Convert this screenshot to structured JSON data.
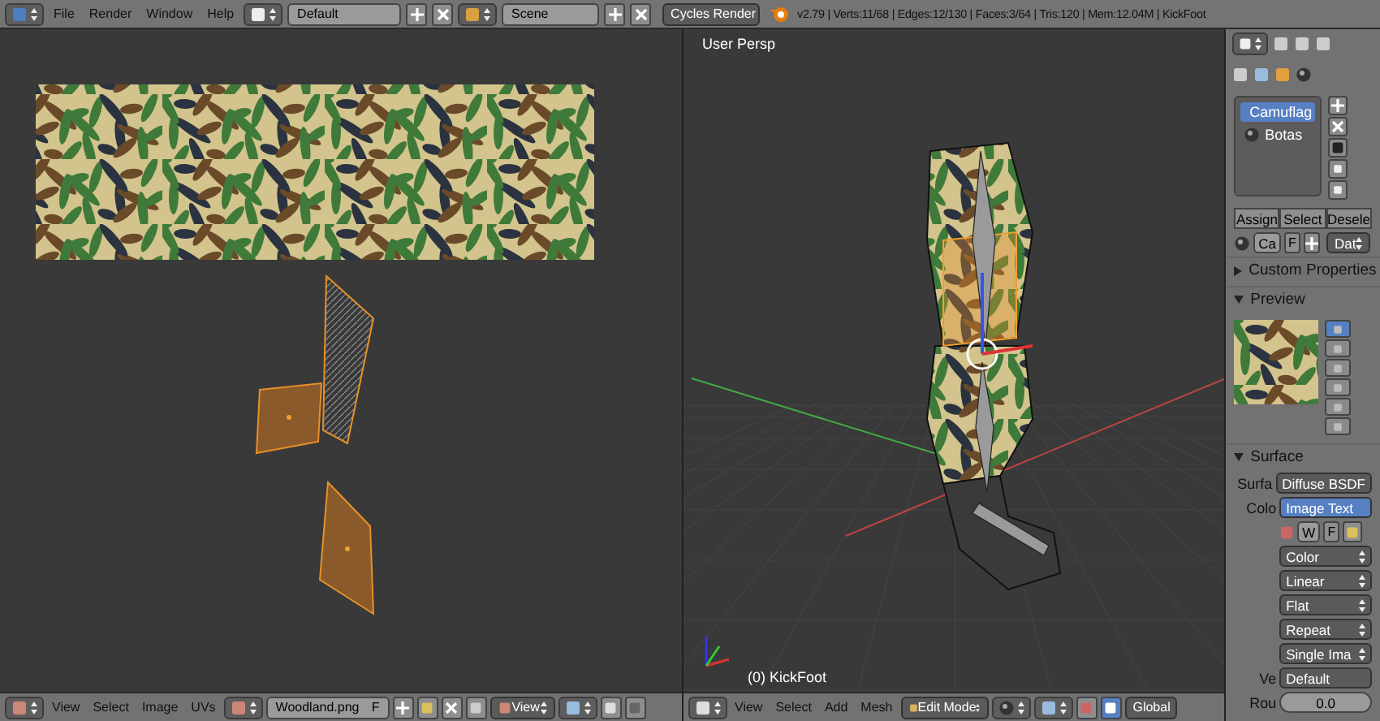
{
  "top_bar": {
    "menus": [
      "File",
      "Render",
      "Window",
      "Help"
    ],
    "layout": "Default",
    "scene": "Scene",
    "engine": "Cycles Render",
    "stats": "v2.79 | Verts:11/68 | Edges:12/130 | Faces:3/64 | Tris:120 | Mem:12.04M | KickFoot"
  },
  "uv_editor": {
    "menus": [
      "View",
      "Select",
      "Image",
      "UVs"
    ],
    "image_name": "Woodland.png",
    "fake_user": "F",
    "display": "View"
  },
  "viewport": {
    "view_label": "User Persp",
    "object_label": "(0) KickFoot",
    "menus": [
      "View",
      "Select",
      "Add",
      "Mesh"
    ],
    "mode": "Edit Mode",
    "orientation": "Global"
  },
  "properties": {
    "materials": [
      {
        "name": "Camuflag",
        "selected": true
      },
      {
        "name": "Botas",
        "selected": false
      }
    ],
    "slot_buttons": [
      "Assign",
      "Select",
      "Desele"
    ],
    "material_field": "Ca",
    "fake_user": "F",
    "data_dropdown": "Dat",
    "panels": [
      {
        "title": "Custom Properties",
        "expanded": false
      },
      {
        "title": "Preview",
        "expanded": true
      },
      {
        "title": "Surface",
        "expanded": true
      }
    ],
    "preview_types": [
      {
        "selected": true
      },
      {
        "selected": false
      },
      {
        "selected": false
      },
      {
        "selected": false
      },
      {
        "selected": false
      },
      {
        "selected": false
      }
    ],
    "surface_label": "Surfa",
    "surface_value": "Diffuse BSDF",
    "color_label": "Colo",
    "color_value": "Image Text",
    "image_field": "W",
    "image_fake_user": "F",
    "dropdowns": [
      "Color",
      "Linear",
      "Flat",
      "Repeat",
      "Single Ima"
    ],
    "vector_label": "Ve",
    "vector_value": "Default",
    "roughness_label": "Rou",
    "roughness_value": "0.0"
  }
}
